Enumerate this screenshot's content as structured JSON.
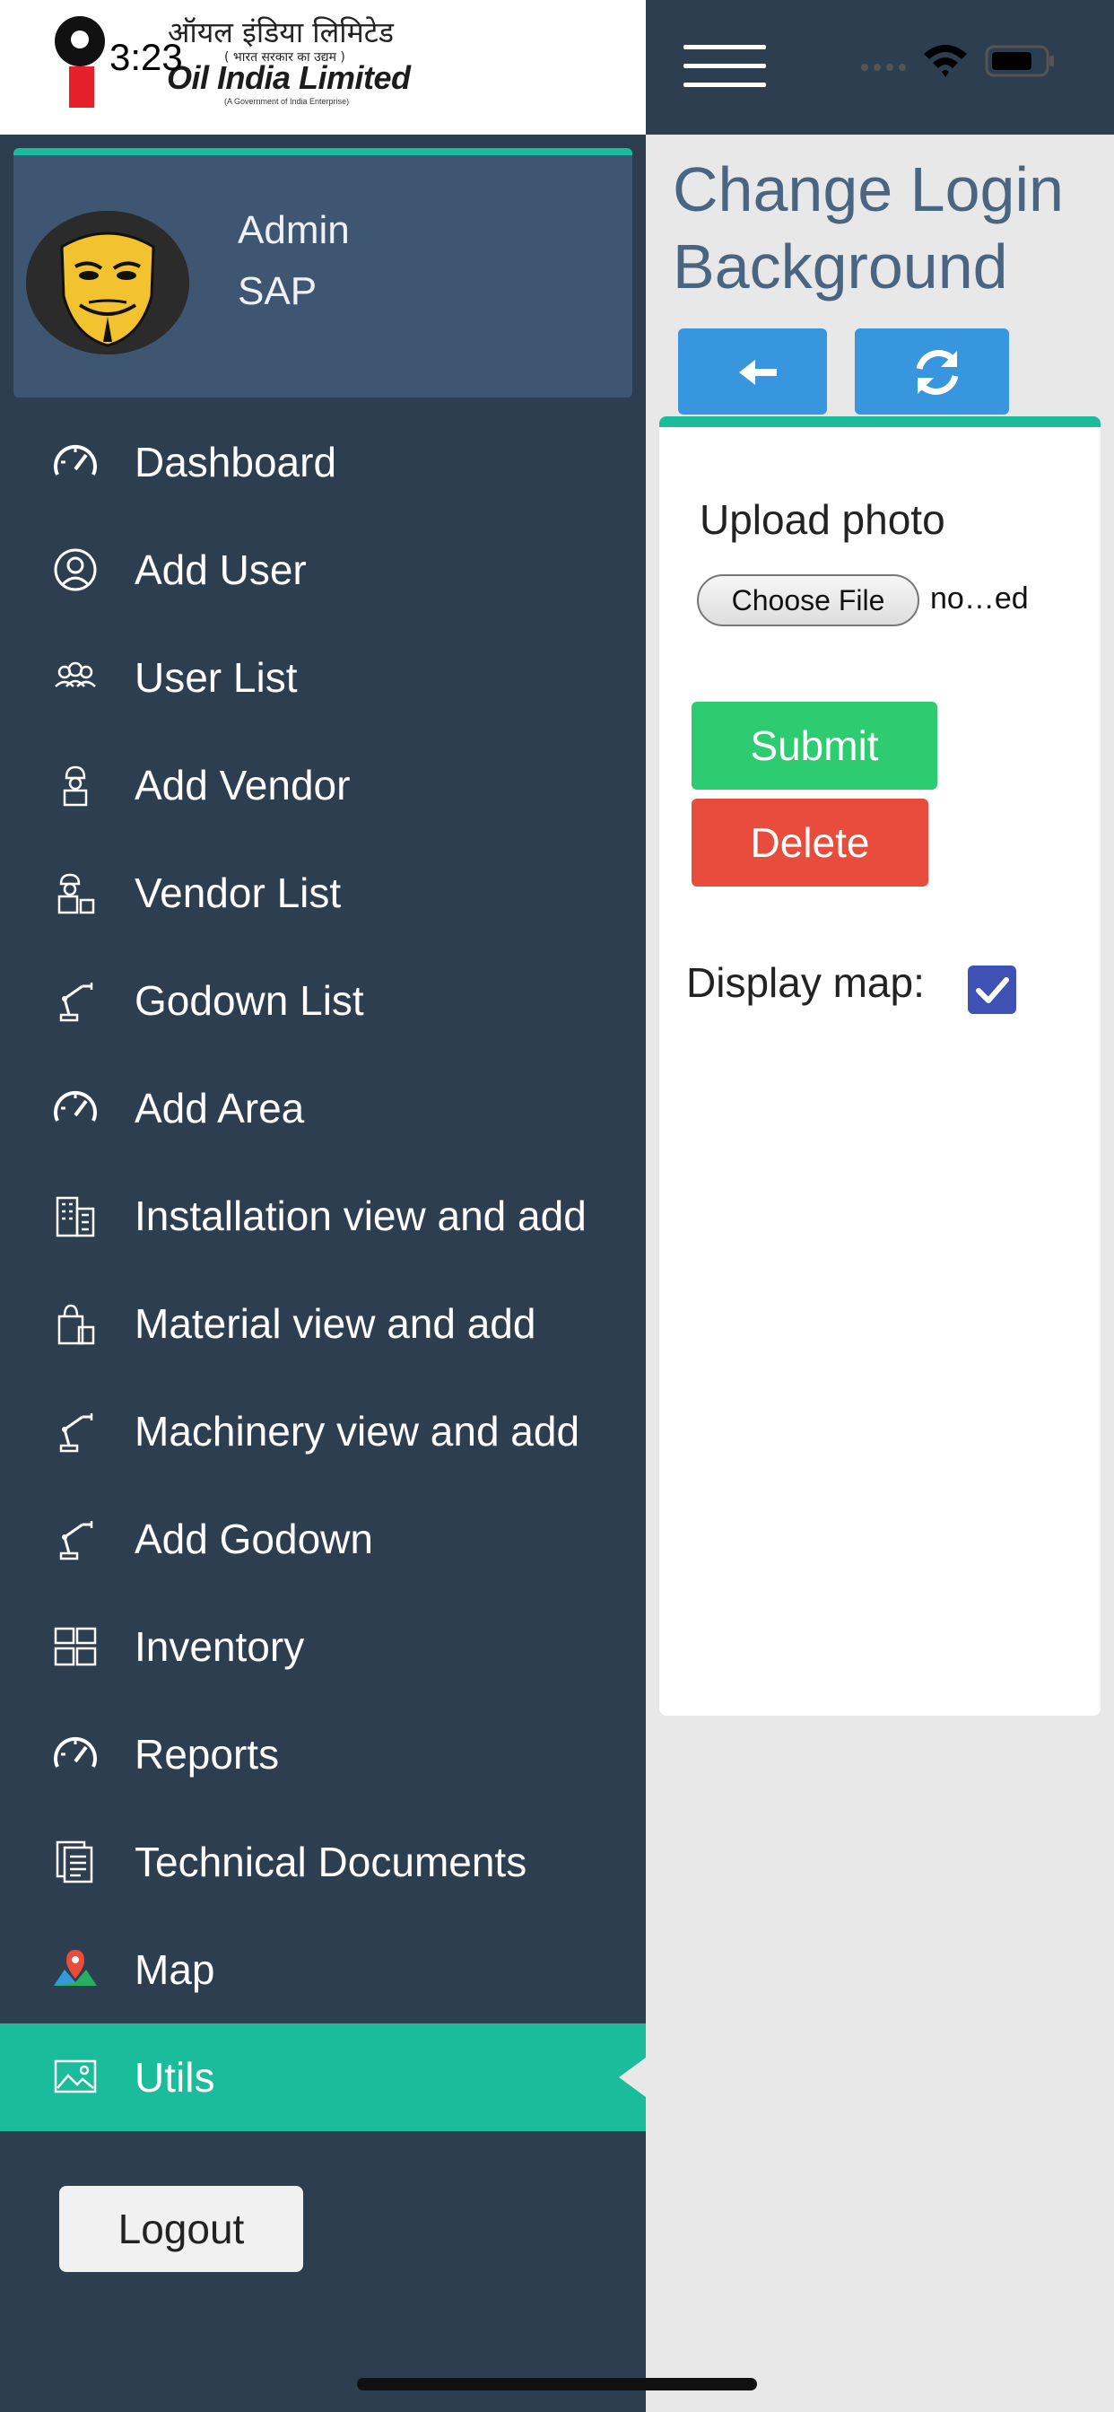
{
  "status_bar": {
    "time": "3:23"
  },
  "logo": {
    "hindi_name": "ऑयल इंडिया लिमिटेड",
    "hindi_subtitle": "( भारत सरकार का उद्यम )",
    "name": "Oil India Limited",
    "tagline": "(A Government of India Enterprise)"
  },
  "profile": {
    "line1": "Admin",
    "line2": "SAP"
  },
  "menu": [
    {
      "label": "Dashboard",
      "icon": "dashboard-gauge-icon"
    },
    {
      "label": "Add User",
      "icon": "user-circle-icon"
    },
    {
      "label": "User List",
      "icon": "users-group-icon"
    },
    {
      "label": "Add Vendor",
      "icon": "worker-icon"
    },
    {
      "label": "Vendor List",
      "icon": "worker-boxes-icon"
    },
    {
      "label": "Godown List",
      "icon": "robot-arm-icon"
    },
    {
      "label": "Add Area",
      "icon": "gauge-icon"
    },
    {
      "label": "Installation view and add",
      "icon": "building-icon"
    },
    {
      "label": "Material view and add",
      "icon": "shopping-bag-icon"
    },
    {
      "label": "Machinery view and add",
      "icon": "robot-arm-icon"
    },
    {
      "label": "Add Godown",
      "icon": "robot-arm-icon"
    },
    {
      "label": "Inventory",
      "icon": "inventory-boxes-icon"
    },
    {
      "label": "Reports",
      "icon": "gauge-icon"
    },
    {
      "label": "Technical Documents",
      "icon": "documents-icon"
    },
    {
      "label": "Map",
      "icon": "map-pin-icon"
    },
    {
      "label": "Utils",
      "icon": "image-icon",
      "active": true
    }
  ],
  "logout_label": "Logout",
  "page": {
    "title": "Change Login Background",
    "upload_label": "Upload photo",
    "choose_file_label": "Choose File",
    "file_name": "no…ed",
    "submit_label": "Submit",
    "delete_label": "Delete",
    "display_map_label": "Display map:",
    "display_map_checked": true
  },
  "colors": {
    "sidebar": "#2d3e50",
    "accent": "#1abc9c",
    "primary_button": "#3796dd",
    "submit": "#2ecc71",
    "delete": "#e74c3c",
    "title": "#4a6582"
  }
}
